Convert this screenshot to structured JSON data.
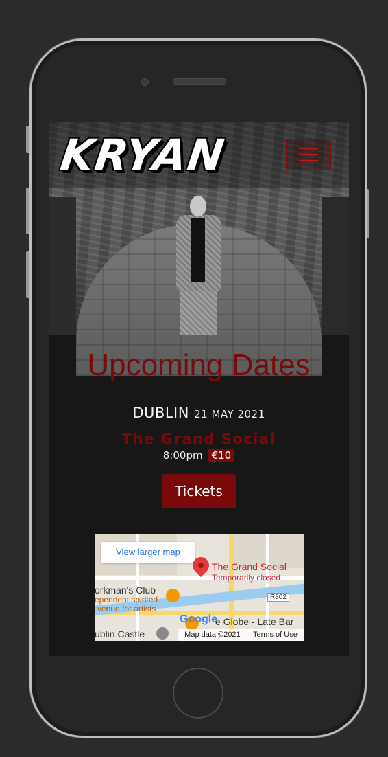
{
  "app": {
    "logo_text": "KRYAN"
  },
  "header": {
    "menu_icon": "hamburger-menu-icon"
  },
  "section": {
    "title": "Upcoming Dates"
  },
  "event": {
    "city": "DUBLIN",
    "date": "21 MAY 2021",
    "venue": "The Grand Social",
    "time": "8:00pm",
    "price": "€10",
    "tickets_label": "Tickets"
  },
  "map": {
    "view_larger_label": "View larger map",
    "place_name": "The Grand Social",
    "place_status": "Temporarily closed",
    "poi_1": "orkman's Club",
    "poi_1_desc_1": "ependent spirited",
    "poi_1_desc_2": "venue for artists",
    "poi_2": "e Globe - Late Bar",
    "poi_3": "ublin Castle",
    "road_label": "R802",
    "google_label": "Google",
    "map_data": "Map data ©2021",
    "terms": "Terms of Use"
  },
  "colors": {
    "accent": "#7a0a0a",
    "background": "#171717",
    "text": "#f2f2f2"
  }
}
